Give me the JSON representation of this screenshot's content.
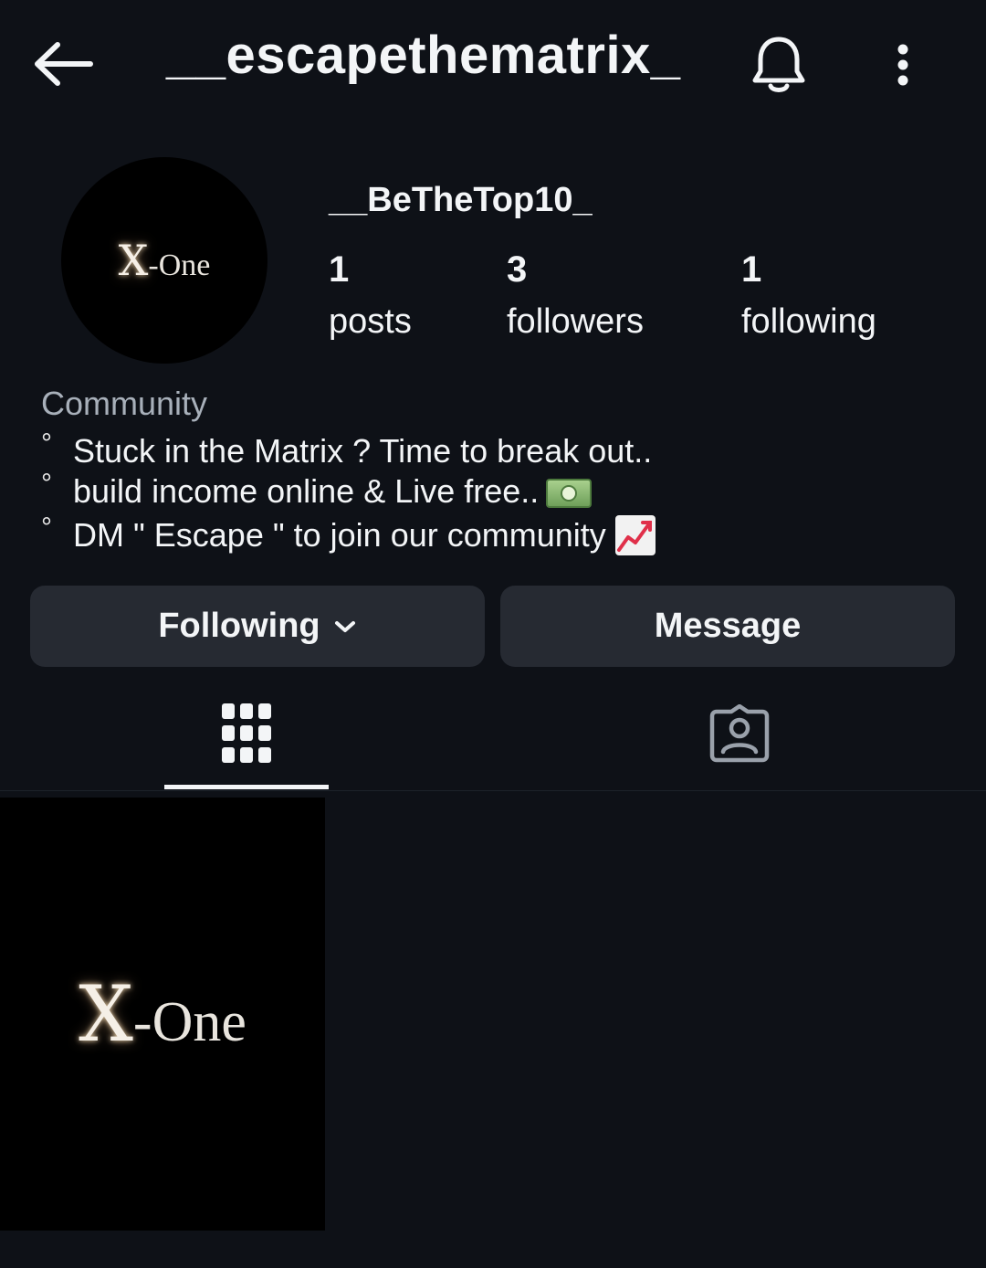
{
  "header": {
    "username": "__escapethematrix_",
    "back_icon": "arrow-left-icon",
    "notify_icon": "bell-icon",
    "more_icon": "more-vertical-icon"
  },
  "profile": {
    "avatar_logo": "X-One",
    "display_name": "__BeTheTop10_",
    "stats": [
      {
        "value": "1",
        "label": "posts"
      },
      {
        "value": "3",
        "label": "followers"
      },
      {
        "value": "1",
        "label": "following"
      }
    ],
    "category": "Community",
    "bio": [
      {
        "bullet": "°",
        "text": "Stuck in the Matrix ? Time to break out..",
        "emoji": ""
      },
      {
        "bullet": "°",
        "text": "build income online & Live free..",
        "emoji": "dollar-banknote"
      },
      {
        "bullet": "°",
        "text": "DM \" Escape \" to join our community",
        "emoji": "chart-increasing"
      }
    ]
  },
  "actions": {
    "following_label": "Following",
    "message_label": "Message"
  },
  "tabs": [
    {
      "icon": "grid-icon",
      "active": true
    },
    {
      "icon": "tagged-person-icon",
      "active": false
    }
  ],
  "posts": [
    {
      "logo": "X-One"
    }
  ],
  "colors": {
    "background": "#0e1117",
    "button": "#262a32",
    "muted_text": "#a8b0ba"
  }
}
